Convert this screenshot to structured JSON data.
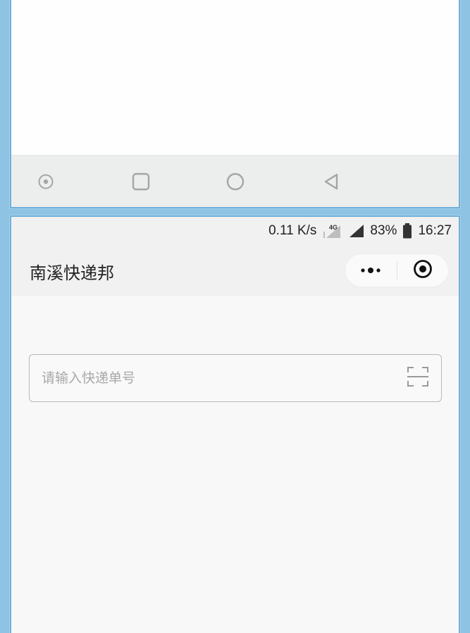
{
  "status_bar": {
    "speed": "0.11 K/s",
    "network": "4G",
    "battery": "83%",
    "time": "16:27"
  },
  "header": {
    "title": "南溪快递邦"
  },
  "search": {
    "value": "",
    "placeholder": "请输入快递单号"
  },
  "icons": {
    "nav_bar": [
      "recent-dot-icon",
      "square-icon",
      "circle-home-icon",
      "back-triangle-icon"
    ],
    "capsule": [
      "more-dots-icon",
      "target-close-icon"
    ],
    "search": "scan-icon",
    "status": [
      "network-4g-icon",
      "signal-icon",
      "battery-icon"
    ]
  },
  "colors": {
    "frame_border": "#6fb0d9",
    "background_outer": "#8ec3e4",
    "nav_bar_bg": "#eceded",
    "title_bar_bg": "#f1f1f1",
    "content_bg": "#f8f8f8",
    "placeholder": "#a8a8a8"
  }
}
